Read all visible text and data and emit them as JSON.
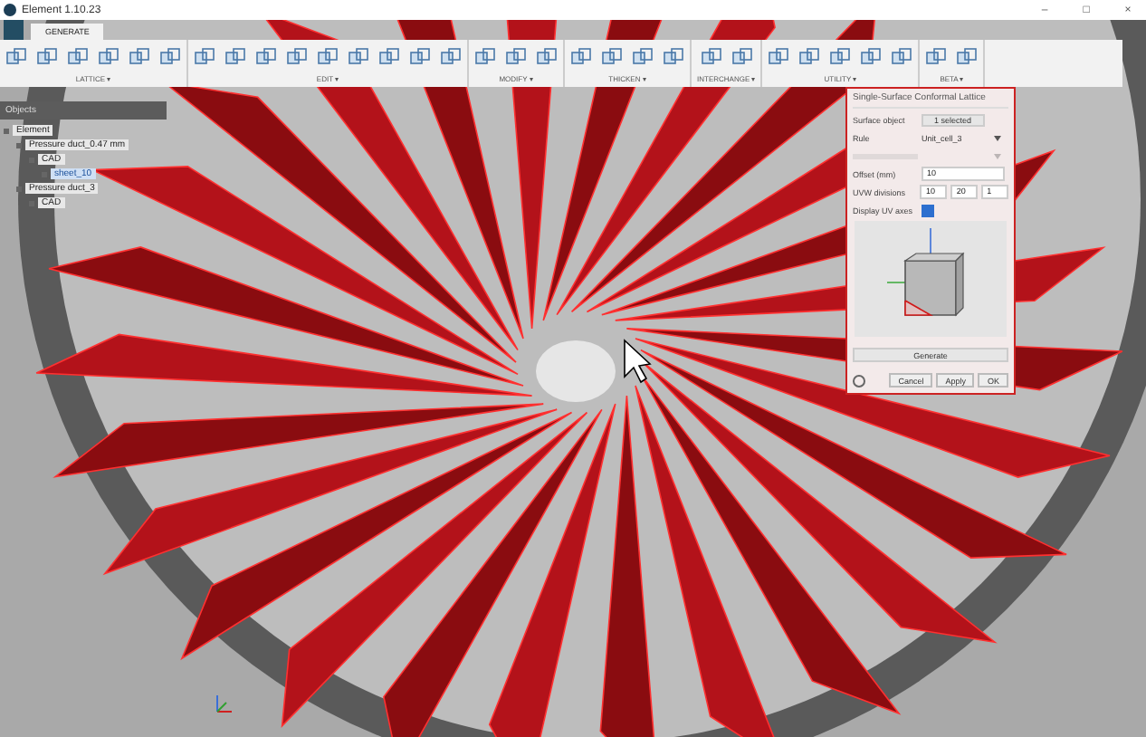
{
  "window": {
    "title": "Element 1.10.23",
    "controls": [
      "–",
      "□",
      "×"
    ]
  },
  "tabs": [
    {
      "label": "GENERATE",
      "selected": true
    }
  ],
  "toolbar_groups": [
    {
      "label": "LATTICE ▾"
    },
    {
      "label": "EDIT ▾"
    },
    {
      "label": "MODIFY ▾"
    },
    {
      "label": "THICKEN ▾"
    },
    {
      "label": "INTERCHANGE ▾"
    },
    {
      "label": "UTILITY ▾"
    },
    {
      "label": "BETA ▾"
    }
  ],
  "objects_panel": {
    "title": "Objects",
    "tree": [
      {
        "label": "Element",
        "children": [
          {
            "label": "Pressure duct_0.47 mm",
            "children": [
              {
                "label": "CAD",
                "children": [
                  {
                    "label": "sheet_10",
                    "selected": true
                  }
                ],
                "selected": false
              }
            ],
            "selected": false
          },
          {
            "label": "Pressure duct_3",
            "children": [
              {
                "label": "CAD",
                "selected": false
              }
            ],
            "selected": false
          }
        ],
        "selected": false
      }
    ]
  },
  "dialog": {
    "title": "Single-Surface Conformal Lattice",
    "fields": [
      {
        "kind": "button",
        "label": "Surface object",
        "value": "1 selected",
        "disabled": false
      },
      {
        "kind": "select",
        "label": "Rule",
        "value": "Unit_cell_3",
        "disabled": false
      },
      {
        "kind": "select",
        "disabled": true
      },
      {
        "kind": "text",
        "label": "Offset (mm)",
        "value": "10",
        "disabled": false
      },
      {
        "kind": "triple",
        "label": "UVW divisions",
        "values": [
          "10",
          "20",
          "1"
        ],
        "disabled": false
      },
      {
        "kind": "check",
        "label": "Display UV axes",
        "checked": true,
        "disabled": false
      }
    ],
    "generate": "Generate",
    "buttons": [
      "Cancel",
      "Apply",
      "OK"
    ]
  }
}
